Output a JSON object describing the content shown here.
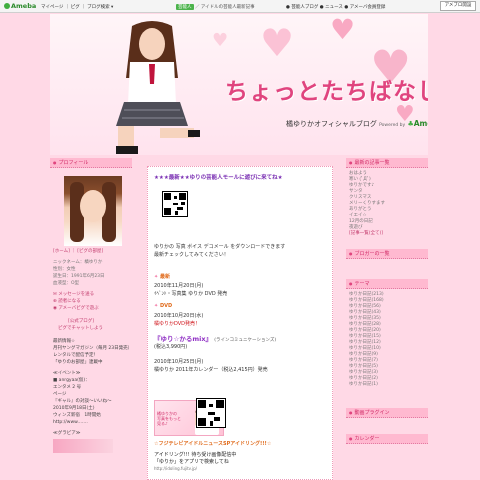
{
  "topbar": {
    "logo": "Ameba",
    "links": "マイページ ｜ ピグ ｜ ブログ検索 ▾",
    "mid_badge": "芸能人",
    "mid_text": "／ アイドルの芸能人最新記事",
    "right_text": "● 芸能人ブログ ● ニュース ● アメーバ会員登録",
    "button": "アメブロ開設"
  },
  "header": {
    "title": "ちょっとたちばなし",
    "subtitle": "橘ゆりかオフィシャルブログ",
    "powered": "Powered by",
    "brand": "Ameba"
  },
  "left": {
    "profile_head": "プロフィール",
    "profile_links": "[ホーム] ｜ [ピグの部屋]",
    "info": [
      "ニックネーム：橘ゆりか",
      "性別：女性",
      "誕生日：1991年6月23日",
      "血液型：O型"
    ],
    "message": "メッセージを送る",
    "reader": "読者になる",
    "pig": "アメーバピグで遊ぶ",
    "official": "[公式ブログ]",
    "pig_talk": "ピグでチャットしよう",
    "news": [
      "最新情報☆",
      "月刊ヤングマガジン（毎月 23日発売）",
      "レンタルで配信予定！",
      "「ゆりのお部屋」連載中"
    ],
    "schedule": [
      "≪イベント≫",
      "■ anrgyaa(仮)：",
      "エンタメ 2 号",
      "ページ",
      "『ギャル』の対談～いいね～",
      "2010年9月18日(土)",
      "ウィンズ新宿　1時開始",
      "http://www.……"
    ],
    "gravure": "≪グラビア≫"
  },
  "center": {
    "title": "★★★最新★★ゆりの芸能人モールに遊びに来てね★",
    "intro": "ゆりかの 写真 ボイス デコメール をダウンロードできます",
    "intro2": "最新チェックしてみてください！",
    "sec1": "最新",
    "sec1_date": "2010年11月20日(月)",
    "sec1_text": "ｲﾍﾞﾝﾄ・写真集 ゆりか DVD 発売",
    "sec2": "DVD",
    "sec2_date": "2010年10月20日(水)",
    "sec2_text": "橘ゆりかDVD発売！",
    "sec3": "『ゆり☆かるmix』",
    "sec3_note": "(ラインコミュニケーションズ)",
    "sec3_price": "(税込3,990円)",
    "sec4_date": "2010年10月25日(月)",
    "sec4_text": "橘ゆりか 2011年カレンダー（税込2,415円）発売",
    "ad_text": [
      "橘ゆりかの",
      "写真をもっと",
      "見る♪"
    ],
    "footer1": "☆フジテレビアイドルニュースSPアイドリング!!!☆",
    "footer2": "アイドリング!!! 待ち受け画像配信中",
    "footer3": "「ゆりか」をアプリで検索してね",
    "footer4": "http://idoling.fujitv.jp/"
  },
  "right": {
    "latest_head": "最新の記事一覧",
    "latest": [
      "おはよう",
      "寒い (ﾟДﾟ)",
      "ゆりかです♪",
      "サンタ",
      "クリスマス",
      "メリーくりすます",
      "ありがとう",
      "イエイ☆",
      "12月の日記",
      "夜遊び",
      "[記事一覧(全て)]"
    ],
    "reader_head": "ブロガーの一覧",
    "theme_head": "テーマ",
    "theme_items": [
      "ゆりか日記(213)",
      "ゆりか日記(168)",
      "ゆりか日記(56)",
      "ゆりか日記(43)",
      "ゆりか日記(35)",
      "ゆりか日記(28)",
      "ゆりか日記(20)",
      "ゆりか日記(15)",
      "ゆりか日記(12)",
      "ゆりか日記(10)",
      "ゆりか日記(9)",
      "ゆりか日記(7)",
      "ゆりか日記(5)",
      "ゆりか日記(3)",
      "ゆりか日記(2)",
      "ゆりか日記(1)"
    ],
    "video_head": "動画プラグイン",
    "calendar_head": "カレンダー"
  }
}
